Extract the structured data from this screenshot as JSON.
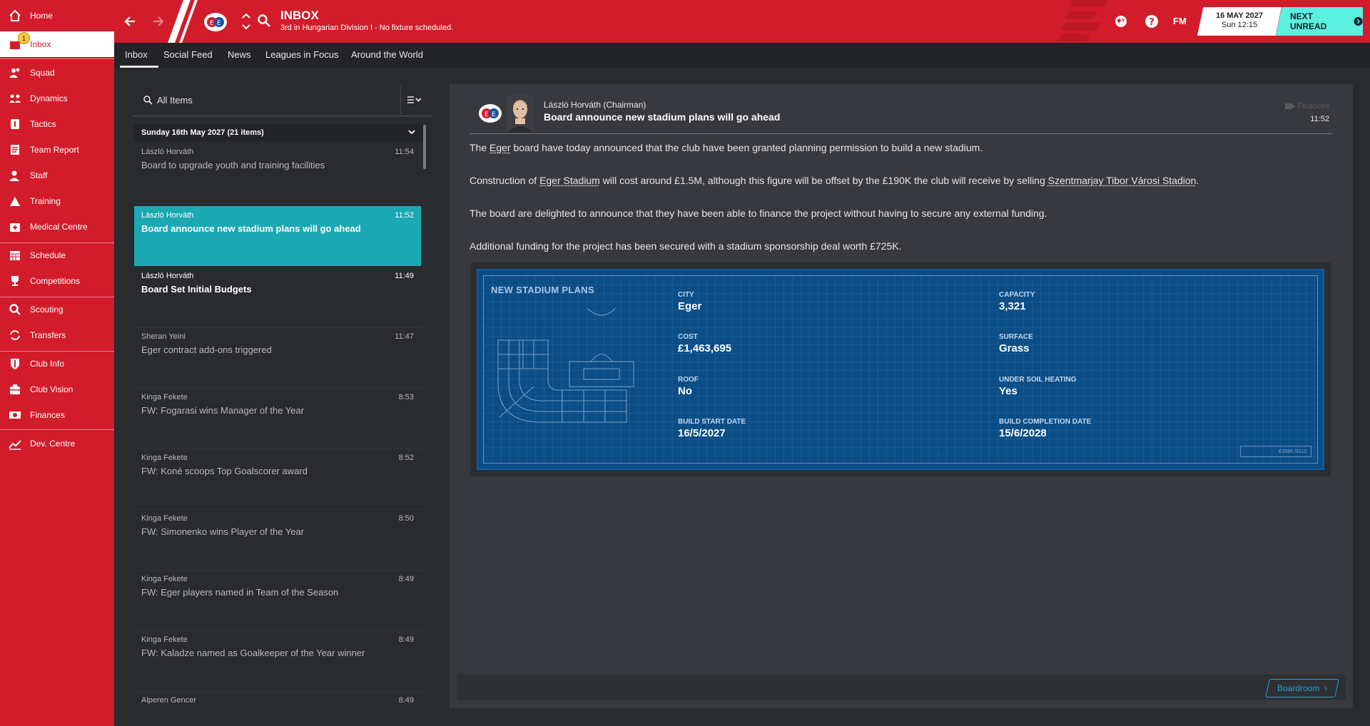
{
  "sidebar": {
    "items": [
      {
        "label": "Home",
        "icon": "home-icon"
      },
      {
        "label": "Inbox",
        "icon": "inbox-icon",
        "badge": "1"
      },
      {
        "label": "Squad",
        "icon": "squad-icon"
      },
      {
        "label": "Dynamics",
        "icon": "dynamics-icon"
      },
      {
        "label": "Tactics",
        "icon": "tactics-icon"
      },
      {
        "label": "Team Report",
        "icon": "team-report-icon"
      },
      {
        "label": "Staff",
        "icon": "staff-icon"
      },
      {
        "label": "Training",
        "icon": "training-icon"
      },
      {
        "label": "Medical Centre",
        "icon": "medical-icon"
      },
      {
        "label": "Schedule",
        "icon": "calendar-icon"
      },
      {
        "label": "Competitions",
        "icon": "trophy-icon"
      },
      {
        "label": "Scouting",
        "icon": "scouting-icon"
      },
      {
        "label": "Transfers",
        "icon": "transfers-icon"
      },
      {
        "label": "Club Info",
        "icon": "shield-icon"
      },
      {
        "label": "Club Vision",
        "icon": "vision-icon"
      },
      {
        "label": "Finances",
        "icon": "finances-icon"
      },
      {
        "label": "Dev. Centre",
        "icon": "dev-centre-icon"
      }
    ]
  },
  "header": {
    "title": "INBOX",
    "subtitle": "3rd in Hungarian Division I - No fixture scheduled.",
    "fm_label": "FM",
    "date": "16 MAY 2027",
    "day_time": "Sun 12:15",
    "next_unread": "NEXT UNREAD"
  },
  "tabs": [
    "Inbox",
    "Social Feed",
    "News",
    "Leagues in Focus",
    "Around the World"
  ],
  "list": {
    "search_label": "All Items",
    "group_header": "Sunday 16th May 2027 (21 items)",
    "messages": [
      {
        "sender": "László Horváth",
        "time": "11:54",
        "subject": "Board to upgrade youth and training facilities"
      },
      {
        "sender": "László Horváth",
        "time": "11:52",
        "subject": "Board announce new stadium plans will go ahead"
      },
      {
        "sender": "László Horváth",
        "time": "11:49",
        "subject": "Board Set Initial Budgets"
      },
      {
        "sender": "Sheran Yeini",
        "time": "11:47",
        "subject": "Eger contract add-ons triggered"
      },
      {
        "sender": "Kinga Fekete",
        "time": "8:53",
        "subject": "FW: Fogarasi wins Manager of the Year"
      },
      {
        "sender": "Kinga Fekete",
        "time": "8:52",
        "subject": "FW: Koné scoops Top Goalscorer award"
      },
      {
        "sender": "Kinga Fekete",
        "time": "8:50",
        "subject": "FW: Simonenko wins Player of the Year"
      },
      {
        "sender": "Kinga Fekete",
        "time": "8:49",
        "subject": "FW: Eger players named in Team of the Season"
      },
      {
        "sender": "Kinga Fekete",
        "time": "8:49",
        "subject": "FW: Kaladze named as Goalkeeper of the Year winner"
      },
      {
        "sender": "Alperen Gencer",
        "time": "8:49",
        "subject": ""
      }
    ]
  },
  "reader": {
    "sender": "László Horváth (Chairman)",
    "subject": "Board announce new stadium plans will go ahead",
    "category": "Finances",
    "time": "11:52",
    "p1_a": "The ",
    "p1_link": "Eger",
    "p1_b": " board have today announced that the club have been granted planning permission to build a new stadium.",
    "p2_a": "Construction of ",
    "p2_link1": "Eger Stadium",
    "p2_b": " will cost around £1.5M, although this figure will be offset by the £190K the club will receive by selling ",
    "p2_link2": "Szentmarjay Tibor Városi Stadion",
    "p2_c": ".",
    "p3": "The board are delighted to announce that they have been able to finance the project without having to secure any external funding.",
    "p4": "Additional funding for the project has been secured with a stadium sponsorship deal worth £725K.",
    "card": {
      "title": "NEW STADIUM PLANS",
      "stamp": "E3588 /0112",
      "fields": {
        "city": {
          "label": "CITY",
          "value": "Eger"
        },
        "capacity": {
          "label": "CAPACITY",
          "value": "3,321"
        },
        "cost": {
          "label": "COST",
          "value": "£1,463,695"
        },
        "surface": {
          "label": "SURFACE",
          "value": "Grass"
        },
        "roof": {
          "label": "ROOF",
          "value": "No"
        },
        "heating": {
          "label": "UNDER SOIL HEATING",
          "value": "Yes"
        },
        "start": {
          "label": "BUILD START DATE",
          "value": "16/5/2027"
        },
        "completion": {
          "label": "BUILD COMPLETION DATE",
          "value": "15/6/2028"
        }
      }
    },
    "footer_button": "Boardroom"
  },
  "colors": {
    "brand_red": "#d21c2b",
    "accent_teal": "#5cf0e0",
    "selected_row": "#1aa9b3",
    "blueprint": "#0b4d86"
  }
}
